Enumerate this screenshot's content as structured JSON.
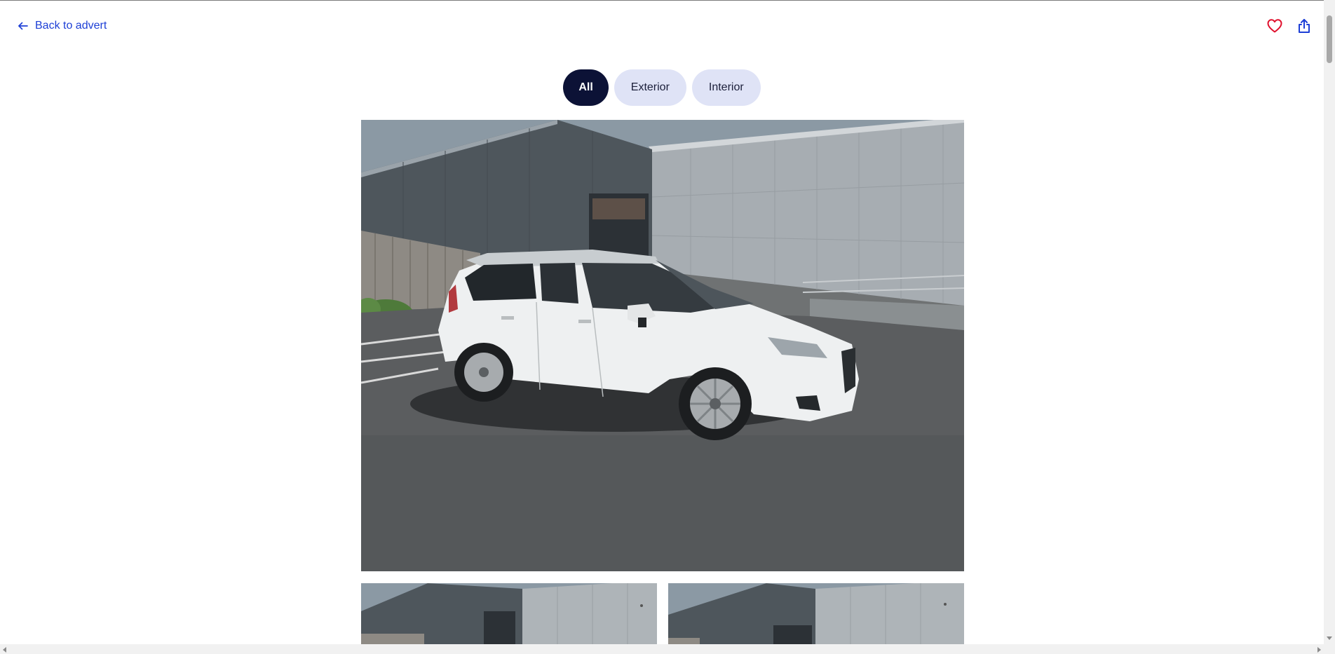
{
  "header": {
    "back_label": "Back to advert",
    "back_icon": "arrow-left-icon",
    "save_icon": "heart-icon",
    "share_icon": "share-icon"
  },
  "filters": [
    {
      "label": "All",
      "selected": true
    },
    {
      "label": "Exterior",
      "selected": false
    },
    {
      "label": "Interior",
      "selected": false
    }
  ],
  "gallery": {
    "main_photo": "White MPV parked in front of grey warehouse",
    "thumbnails": [
      "Grey warehouse building photo",
      "Grey warehouse building photo"
    ]
  },
  "colors": {
    "accent_blue": "#1d3fd6",
    "heart_red": "#e0102d",
    "chip_active_bg": "#0c1236",
    "chip_bg": "#dfe3f6"
  }
}
